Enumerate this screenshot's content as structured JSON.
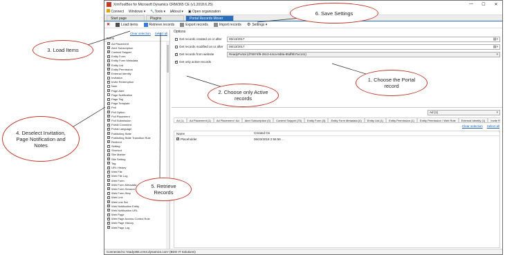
{
  "window": {
    "title": "XrmToolBox for Microsoft Dynamics CRM/365 CE (v1.2018.6.25)",
    "controls": [
      "—",
      "☐",
      "✕"
    ]
  },
  "menubar": {
    "connect": "Connect",
    "windows": "Windows ▾",
    "tools": "Tools ▾",
    "about": "About ▾",
    "open_org": "Open organization"
  },
  "tabs": [
    "Start page",
    "Plugins",
    "Portal Records Mover (Ready...  ✕"
  ],
  "toolbar": {
    "load_items": "Load items",
    "retrieve": "Retrieve records",
    "export": "Export records",
    "import": "Import records",
    "settings": "Settings ▾"
  },
  "left": {
    "clear": "Clear selection",
    "select_all": "Select all",
    "header": "Items",
    "items": [
      {
        "label": "Ad Placement",
        "checked": true
      },
      {
        "label": "Alert Subscription",
        "checked": true
      },
      {
        "label": "Content Snippet",
        "checked": true
      },
      {
        "label": "Entity Form",
        "checked": true
      },
      {
        "label": "Entity Form Metadata",
        "checked": true
      },
      {
        "label": "Entity List",
        "checked": true
      },
      {
        "label": "Entity Permission",
        "checked": true
      },
      {
        "label": "External Identity",
        "checked": true
      },
      {
        "label": "Invitation",
        "checked": false
      },
      {
        "label": "Invite Redemption",
        "checked": true
      },
      {
        "label": "Note",
        "checked": false
      },
      {
        "label": "Page Alert",
        "checked": true
      },
      {
        "label": "Page Notification",
        "checked": false
      },
      {
        "label": "Page Tag",
        "checked": true
      },
      {
        "label": "Page Template",
        "checked": true
      },
      {
        "label": "Poll",
        "checked": true
      },
      {
        "label": "Poll Option",
        "checked": true
      },
      {
        "label": "Poll Placement",
        "checked": true
      },
      {
        "label": "Poll Submission",
        "checked": true
      },
      {
        "label": "Portal Comment",
        "checked": true
      },
      {
        "label": "Portal Language",
        "checked": true
      },
      {
        "label": "Publishing State",
        "checked": true
      },
      {
        "label": "Publishing State Transition Rule",
        "checked": true
      },
      {
        "label": "Redirect",
        "checked": true
      },
      {
        "label": "Setting",
        "checked": true
      },
      {
        "label": "Shortcut",
        "checked": true
      },
      {
        "label": "Site Marker",
        "checked": true
      },
      {
        "label": "Site Setting",
        "checked": true
      },
      {
        "label": "Tag",
        "checked": true
      },
      {
        "label": "URL History",
        "checked": true
      },
      {
        "label": "Web File",
        "checked": true
      },
      {
        "label": "Web File Log",
        "checked": true
      },
      {
        "label": "Web Form",
        "checked": true
      },
      {
        "label": "Web Form Metadata",
        "checked": true
      },
      {
        "label": "Web Form Session",
        "checked": true
      },
      {
        "label": "Web Form Step",
        "checked": true
      },
      {
        "label": "Web Link",
        "checked": true
      },
      {
        "label": "Web Link Set",
        "checked": true
      },
      {
        "label": "Web Notification Entity",
        "checked": true
      },
      {
        "label": "Web Notification URL",
        "checked": true
      },
      {
        "label": "Web Page",
        "checked": true
      },
      {
        "label": "Web Page Access Control Rule",
        "checked": true
      },
      {
        "label": "Web Page History",
        "checked": true
      },
      {
        "label": "Web Page Log",
        "checked": true
      }
    ]
  },
  "options": {
    "title": "Options",
    "created_after": {
      "label": "Get records created on or after",
      "value": "06/13/2017",
      "checked": false
    },
    "modified_after": {
      "label": "Get records modified on or after",
      "value": "06/13/2017",
      "checked": false
    },
    "from_website": {
      "label": "Get records from website",
      "value": "ReadyPortal (d76974f9-28c3-44ca-8d8a-85df9b7ac141)",
      "checked": true
    },
    "active_only": {
      "label": "Get only active records",
      "checked": true
    }
  },
  "entity_select": "Ad (1)",
  "entity_tabs": [
    "Ad (1)",
    "Ad Placement (1)",
    "Ad Placement / Ad",
    "Alert Subscription (0)",
    "Content Snippet (75)",
    "Entity Form (3)",
    "Entity Form Metadata (0)",
    "Entity List (1)",
    "Entity Permission (1)",
    "Entity Permission / Web Role",
    "External Identity (1)",
    "Invite Redemption"
  ],
  "grid_links": {
    "clear": "Clear selection",
    "select_all": "Select all"
  },
  "grid": {
    "headers": [
      "Name",
      "Created On"
    ],
    "rows": [
      {
        "name": "Placeholder",
        "created": "06/23/2018 2:55:56 ..."
      }
    ]
  },
  "status": "Connected to 'ready365.crm3.dynamics.com' (BDO IT Solutions)",
  "callouts": {
    "c1": "1. Choose the Portal record",
    "c2": "2. Choose only Active records",
    "c3": "3. Load Items",
    "c4": "4. Deselect Invitation, Page Notification and Notes",
    "c5": "5. Retrieve Records",
    "c6": "6. Save Settings"
  },
  "colors": {
    "accent": "#2a6ebb",
    "callout_border": "#c0392b",
    "link": "#1a5db5"
  }
}
